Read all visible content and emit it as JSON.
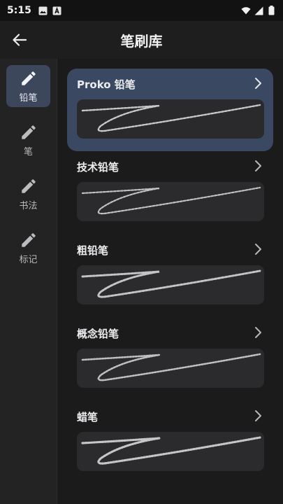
{
  "status_bar": {
    "time": "5:15"
  },
  "app_bar": {
    "title": "笔刷库"
  },
  "sidebar": {
    "items": [
      {
        "label": "铅笔",
        "active": true
      },
      {
        "label": "笔",
        "active": false
      },
      {
        "label": "书法",
        "active": false
      },
      {
        "label": "标记",
        "active": false
      }
    ]
  },
  "brushes": [
    {
      "name": "Proko 铅笔",
      "selected": true
    },
    {
      "name": "技术铅笔",
      "selected": false
    },
    {
      "name": "粗铅笔",
      "selected": false
    },
    {
      "name": "概念铅笔",
      "selected": false
    },
    {
      "name": "蜡笔",
      "selected": false
    }
  ],
  "colors": {
    "background": "#1b1b1c",
    "sidebar": "#232324",
    "active_accent": "#3d475c",
    "selected_card": "#3a4862",
    "preview_bg": "#2b2b2d"
  }
}
